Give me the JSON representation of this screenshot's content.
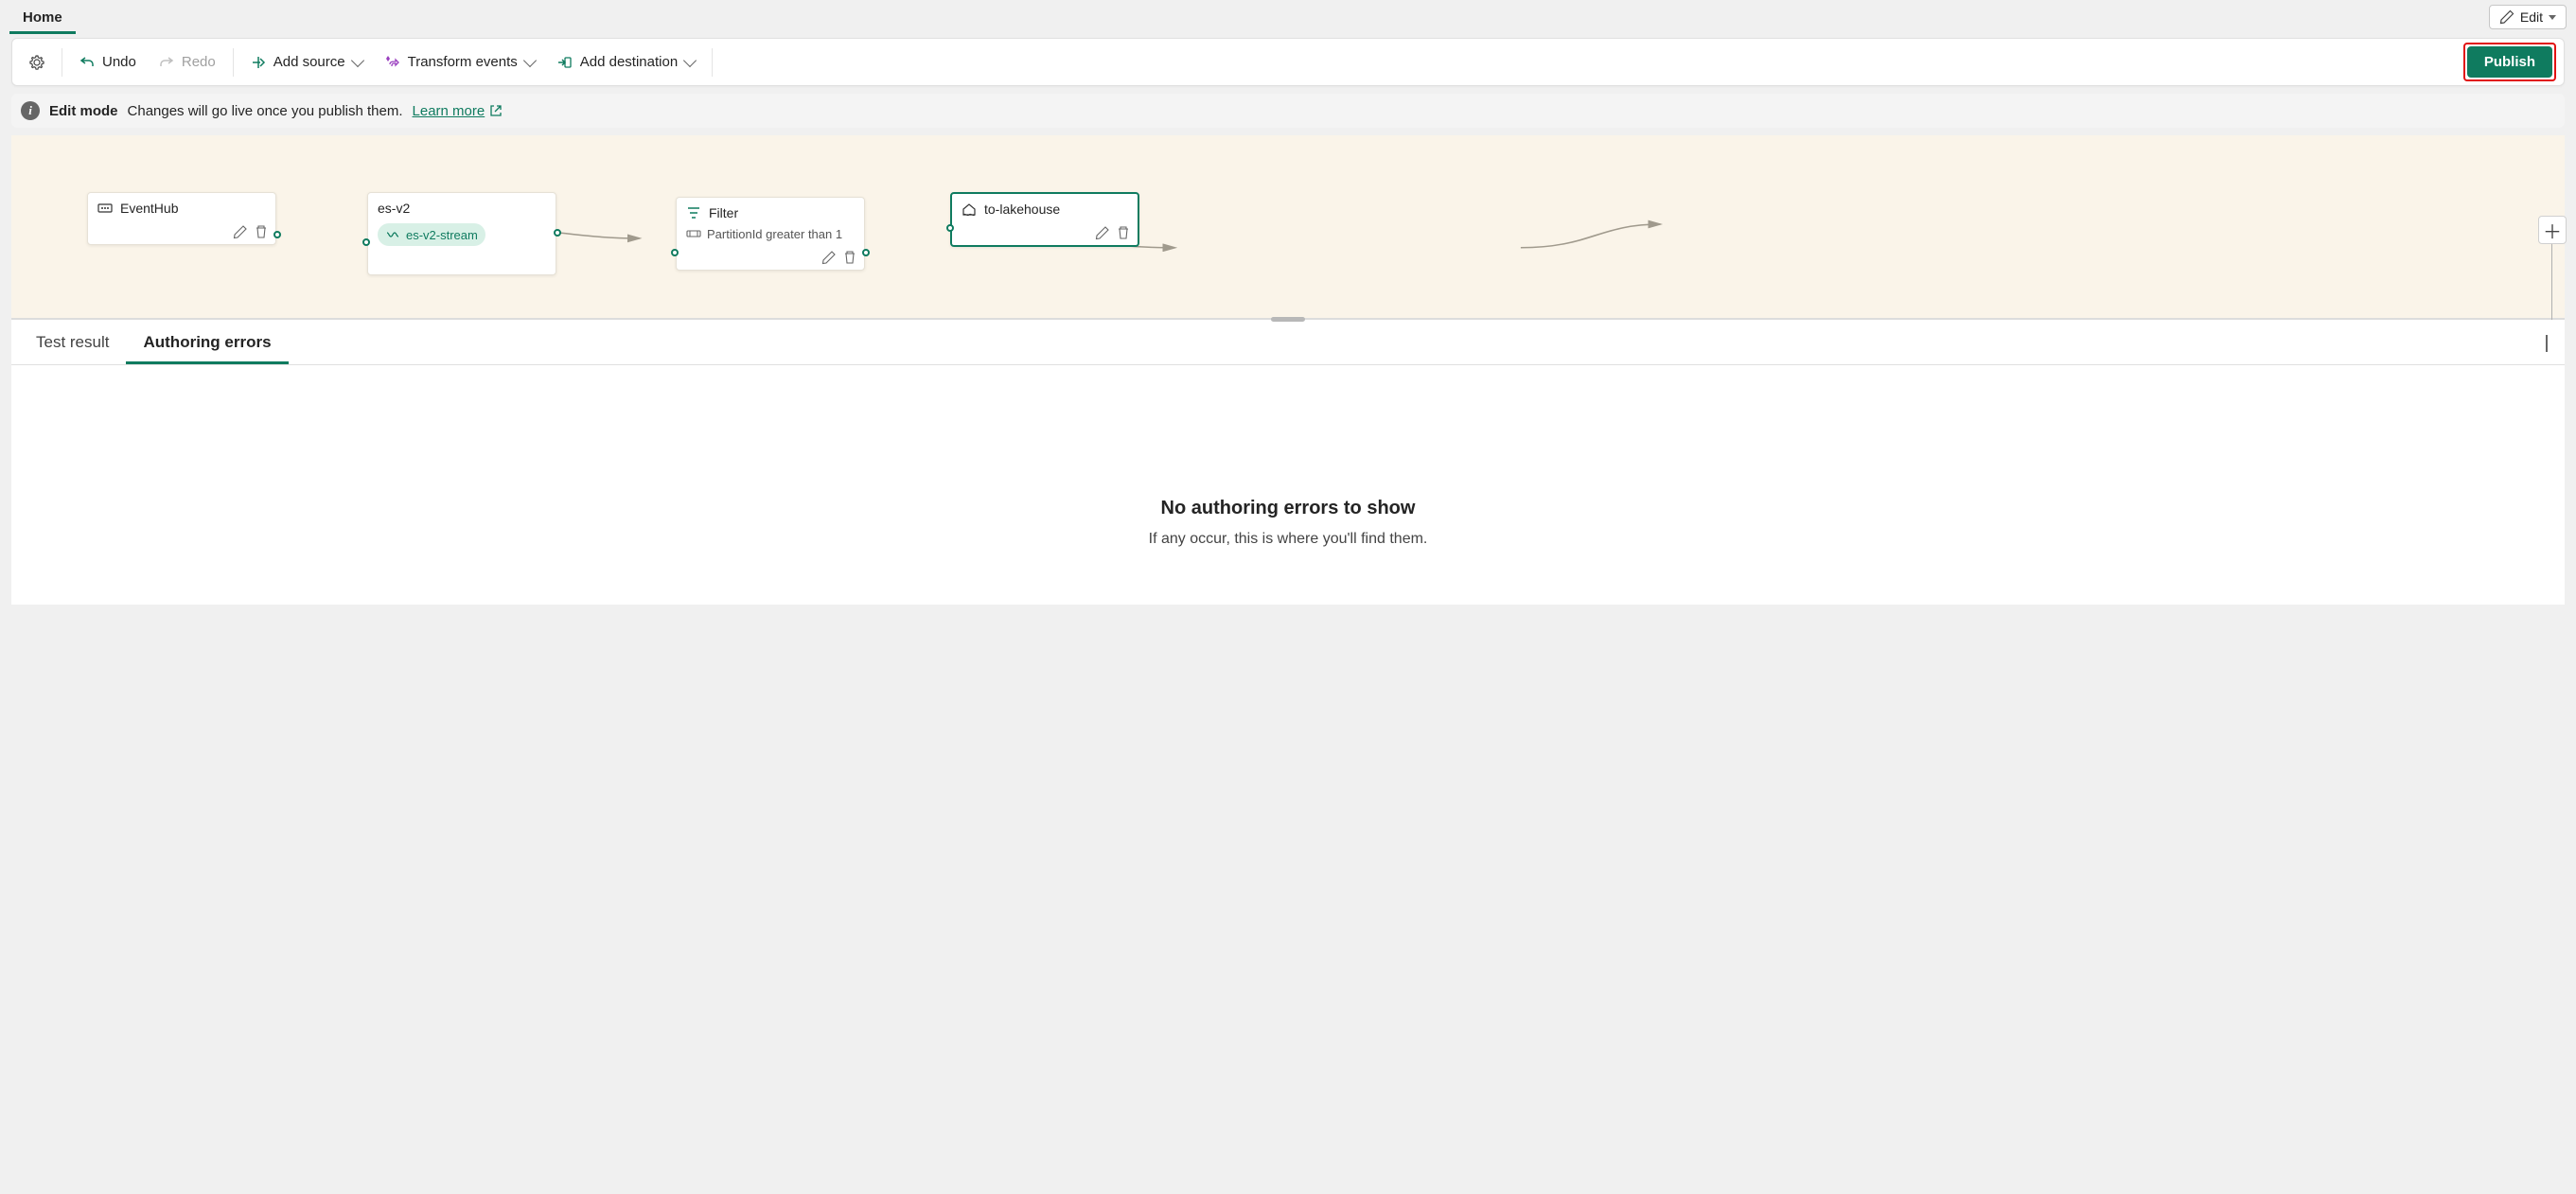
{
  "ribbon": {
    "home_label": "Home",
    "edit_label": "Edit"
  },
  "toolbar": {
    "undo_label": "Undo",
    "redo_label": "Redo",
    "add_source_label": "Add source",
    "transform_label": "Transform events",
    "add_destination_label": "Add destination",
    "publish_label": "Publish"
  },
  "infobar": {
    "mode_label": "Edit mode",
    "message": "Changes will go live once you publish them.",
    "learn_more": "Learn more"
  },
  "nodes": {
    "source": {
      "title": "EventHub"
    },
    "stream": {
      "title": "es-v2",
      "chip": "es-v2-stream"
    },
    "filter": {
      "title": "Filter",
      "rule": "PartitionId greater than 1"
    },
    "dest": {
      "title": "to-lakehouse"
    }
  },
  "panel": {
    "tabs": {
      "test_result": "Test result",
      "authoring_errors": "Authoring errors"
    },
    "empty_title": "No authoring errors to show",
    "empty_sub": "If any occur, this is where you'll find them."
  }
}
